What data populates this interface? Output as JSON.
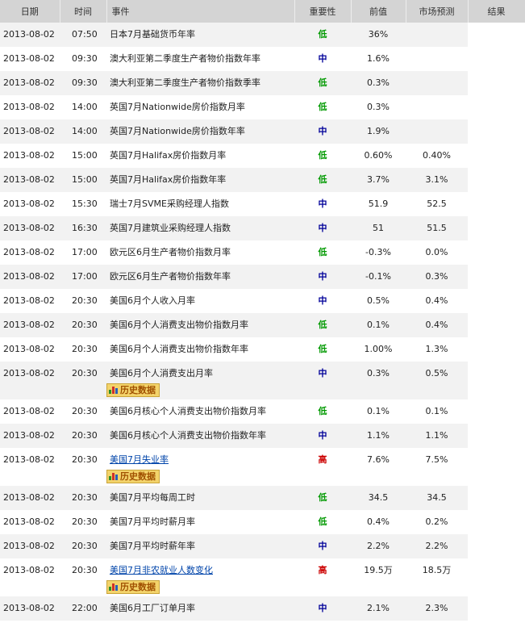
{
  "headers": {
    "date": "日期",
    "time": "时间",
    "event": "事件",
    "importance": "重要性",
    "previous": "前值",
    "forecast": "市场预测",
    "result": "结果"
  },
  "history_label": "历史数据",
  "importance_colors": {
    "低": "#009900",
    "中": "#000099",
    "高": "#cc0000"
  },
  "rows": [
    {
      "date": "2013-08-02",
      "time": "07:50",
      "event": "日本7月基础货币年率",
      "importance": "低",
      "previous": "36%",
      "forecast": "",
      "result": "",
      "link": false,
      "history": false
    },
    {
      "date": "2013-08-02",
      "time": "09:30",
      "event": "澳大利亚第二季度生产者物价指数年率",
      "importance": "中",
      "previous": "1.6%",
      "forecast": "",
      "result": "",
      "link": false,
      "history": false
    },
    {
      "date": "2013-08-02",
      "time": "09:30",
      "event": "澳大利亚第二季度生产者物价指数季率",
      "importance": "低",
      "previous": "0.3%",
      "forecast": "",
      "result": "",
      "link": false,
      "history": false
    },
    {
      "date": "2013-08-02",
      "time": "14:00",
      "event": "英国7月Nationwide房价指数月率",
      "importance": "低",
      "previous": "0.3%",
      "forecast": "",
      "result": "",
      "link": false,
      "history": false
    },
    {
      "date": "2013-08-02",
      "time": "14:00",
      "event": "英国7月Nationwide房价指数年率",
      "importance": "中",
      "previous": "1.9%",
      "forecast": "",
      "result": "",
      "link": false,
      "history": false
    },
    {
      "date": "2013-08-02",
      "time": "15:00",
      "event": "英国7月Halifax房价指数月率",
      "importance": "低",
      "previous": "0.60%",
      "forecast": "0.40%",
      "result": "",
      "link": false,
      "history": false
    },
    {
      "date": "2013-08-02",
      "time": "15:00",
      "event": "英国7月Halifax房价指数年率",
      "importance": "低",
      "previous": "3.7%",
      "forecast": "3.1%",
      "result": "",
      "link": false,
      "history": false
    },
    {
      "date": "2013-08-02",
      "time": "15:30",
      "event": "瑞士7月SVME采购经理人指数",
      "importance": "中",
      "previous": "51.9",
      "forecast": "52.5",
      "result": "",
      "link": false,
      "history": false
    },
    {
      "date": "2013-08-02",
      "time": "16:30",
      "event": "英国7月建筑业采购经理人指数",
      "importance": "中",
      "previous": "51",
      "forecast": "51.5",
      "result": "",
      "link": false,
      "history": false
    },
    {
      "date": "2013-08-02",
      "time": "17:00",
      "event": "欧元区6月生产者物价指数月率",
      "importance": "低",
      "previous": "-0.3%",
      "forecast": "0.0%",
      "result": "",
      "link": false,
      "history": false
    },
    {
      "date": "2013-08-02",
      "time": "17:00",
      "event": "欧元区6月生产者物价指数年率",
      "importance": "中",
      "previous": "-0.1%",
      "forecast": "0.3%",
      "result": "",
      "link": false,
      "history": false
    },
    {
      "date": "2013-08-02",
      "time": "20:30",
      "event": "美国6月个人收入月率",
      "importance": "中",
      "previous": "0.5%",
      "forecast": "0.4%",
      "result": "",
      "link": false,
      "history": false
    },
    {
      "date": "2013-08-02",
      "time": "20:30",
      "event": "美国6月个人消费支出物价指数月率",
      "importance": "低",
      "previous": "0.1%",
      "forecast": "0.4%",
      "result": "",
      "link": false,
      "history": false
    },
    {
      "date": "2013-08-02",
      "time": "20:30",
      "event": "美国6月个人消费支出物价指数年率",
      "importance": "低",
      "previous": "1.00%",
      "forecast": "1.3%",
      "result": "",
      "link": false,
      "history": false
    },
    {
      "date": "2013-08-02",
      "time": "20:30",
      "event": "美国6月个人消费支出月率",
      "importance": "中",
      "previous": "0.3%",
      "forecast": "0.5%",
      "result": "",
      "link": false,
      "history": true
    },
    {
      "date": "2013-08-02",
      "time": "20:30",
      "event": "美国6月核心个人消费支出物价指数月率",
      "importance": "低",
      "previous": "0.1%",
      "forecast": "0.1%",
      "result": "",
      "link": false,
      "history": false
    },
    {
      "date": "2013-08-02",
      "time": "20:30",
      "event": "美国6月核心个人消费支出物价指数年率",
      "importance": "中",
      "previous": "1.1%",
      "forecast": "1.1%",
      "result": "",
      "link": false,
      "history": false
    },
    {
      "date": "2013-08-02",
      "time": "20:30",
      "event": "美国7月失业率",
      "importance": "高",
      "previous": "7.6%",
      "forecast": "7.5%",
      "result": "",
      "link": true,
      "history": true
    },
    {
      "date": "2013-08-02",
      "time": "20:30",
      "event": "美国7月平均每周工时",
      "importance": "低",
      "previous": "34.5",
      "forecast": "34.5",
      "result": "",
      "link": false,
      "history": false
    },
    {
      "date": "2013-08-02",
      "time": "20:30",
      "event": "美国7月平均时薪月率",
      "importance": "低",
      "previous": "0.4%",
      "forecast": "0.2%",
      "result": "",
      "link": false,
      "history": false
    },
    {
      "date": "2013-08-02",
      "time": "20:30",
      "event": "美国7月平均时薪年率",
      "importance": "中",
      "previous": "2.2%",
      "forecast": "2.2%",
      "result": "",
      "link": false,
      "history": false
    },
    {
      "date": "2013-08-02",
      "time": "20:30",
      "event": "美国7月非农就业人数变化",
      "importance": "高",
      "previous": "19.5万",
      "forecast": "18.5万",
      "result": "",
      "link": true,
      "history": true
    },
    {
      "date": "2013-08-02",
      "time": "22:00",
      "event": "美国6月工厂订单月率",
      "importance": "中",
      "previous": "2.1%",
      "forecast": "2.3%",
      "result": "",
      "link": false,
      "history": false
    }
  ]
}
